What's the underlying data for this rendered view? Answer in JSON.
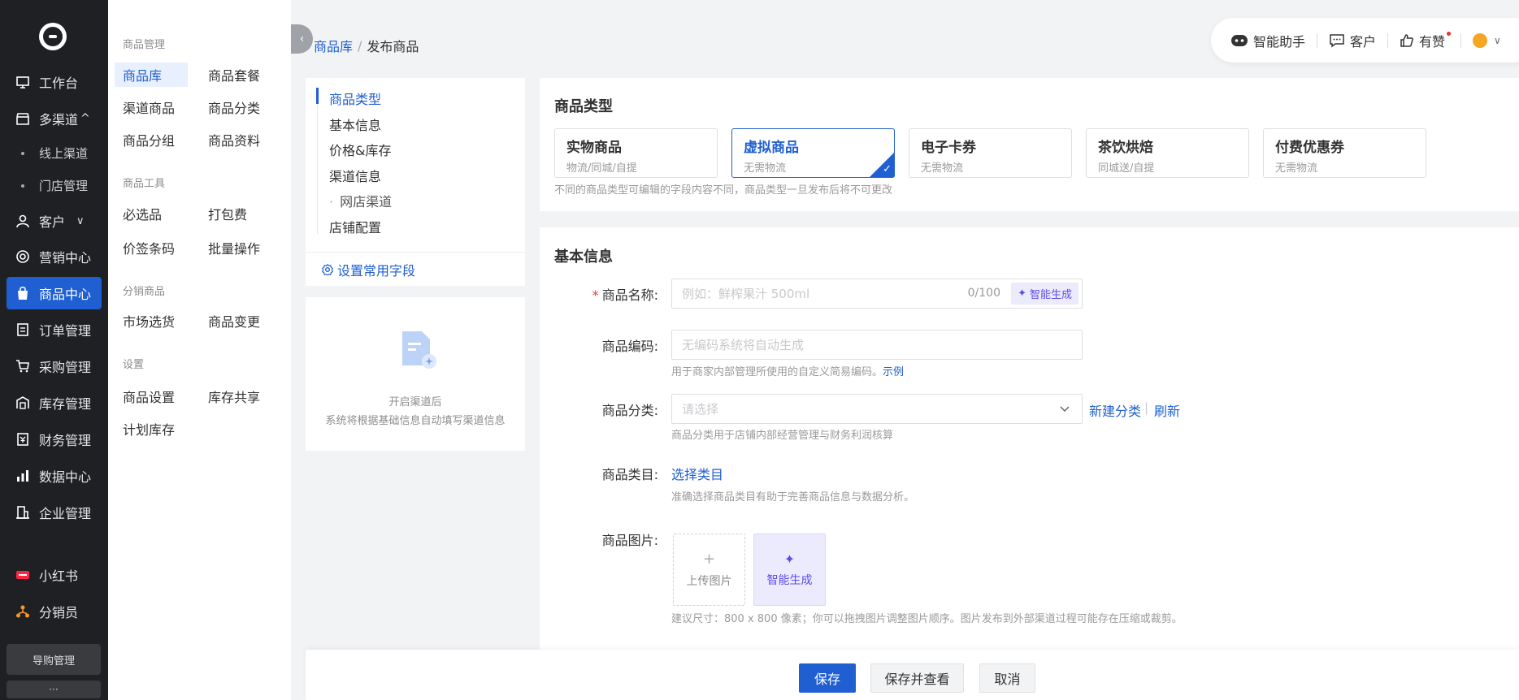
{
  "sidebar": {
    "items": [
      {
        "label": "工作台"
      },
      {
        "label": "多渠道"
      },
      {
        "label": "客户"
      },
      {
        "label": "营销中心"
      },
      {
        "label": "商品中心"
      },
      {
        "label": "订单管理"
      },
      {
        "label": "采购管理"
      },
      {
        "label": "库存管理"
      },
      {
        "label": "财务管理"
      },
      {
        "label": "数据中心"
      },
      {
        "label": "企业管理"
      },
      {
        "label": "小红书"
      },
      {
        "label": "分销员"
      }
    ],
    "sub_items": [
      "线上渠道",
      "门店管理"
    ],
    "guide_label": "导购管理",
    "more_label": "···",
    "expand_up": "^",
    "expand_down": "∨"
  },
  "subnav": {
    "sections": [
      {
        "title": "商品管理",
        "links": [
          "商品库",
          "商品套餐",
          "渠道商品",
          "商品分类",
          "商品分组",
          "商品资料"
        ]
      },
      {
        "title": "商品工具",
        "links": [
          "必选品",
          "打包费",
          "价签条码",
          "批量操作"
        ]
      },
      {
        "title": "分销商品",
        "links": [
          "市场选货",
          "商品变更"
        ]
      },
      {
        "title": "设置",
        "links": [
          "商品设置",
          "库存共享",
          "计划库存"
        ]
      }
    ]
  },
  "breadcrumb": {
    "parent": "商品库",
    "sep": "/",
    "current": "发布商品"
  },
  "topbar": {
    "assistant": "智能助手",
    "customer": "客户",
    "youzan": "有赞"
  },
  "anchor": {
    "items": [
      "商品类型",
      "基本信息",
      "价格&库存",
      "渠道信息",
      "网店渠道",
      "店铺配置"
    ],
    "sub_dot": "·",
    "settings": "设置常用字段"
  },
  "channel_card": {
    "line1": "开启渠道后",
    "line2": "系统将根据基础信息自动填写渠道信息"
  },
  "product_type": {
    "title": "商品类型",
    "options": [
      {
        "name": "实物商品",
        "desc": "物流/同城/自提"
      },
      {
        "name": "虚拟商品",
        "desc": "无需物流"
      },
      {
        "name": "电子卡券",
        "desc": "无需物流"
      },
      {
        "name": "茶饮烘焙",
        "desc": "同城送/自提"
      },
      {
        "name": "付费优惠券",
        "desc": "无需物流"
      }
    ],
    "selected": 1,
    "hint": "不同的商品类型可编辑的字段内容不同，商品类型一旦发布后将不可更改"
  },
  "basic_info": {
    "title": "基本信息",
    "name_label": "商品名称:",
    "required_mark": "*",
    "name_placeholder": "例如：鲜榨果汁 500ml",
    "name_counter": "0/100",
    "ai_generate": "智能生成",
    "code_label": "商品编码:",
    "code_placeholder": "无编码系统将自动生成",
    "code_hint": "用于商家内部管理所使用的自定义简易编码。",
    "code_hint_link": "示例",
    "category_label": "商品分类:",
    "category_placeholder": "请选择",
    "new_category": "新建分类",
    "link_sep": "|",
    "refresh": "刷新",
    "category_hint": "商品分类用于店铺内部经营管理与财务利润核算",
    "class_label": "商品类目:",
    "class_link": "选择类目",
    "class_hint": "准确选择商品类目有助于完善商品信息与数据分析。",
    "image_label": "商品图片:",
    "upload_plus": "+",
    "upload_label": "上传图片",
    "image_ai": "智能生成",
    "image_hint": "建议尺寸：800 x 800 像素；你可以拖拽图片调整图片顺序。图片发布到外部渠道过程可能存在压缩或裁剪。"
  },
  "footer": {
    "save": "保存",
    "save_view": "保存并查看",
    "cancel": "取消"
  }
}
